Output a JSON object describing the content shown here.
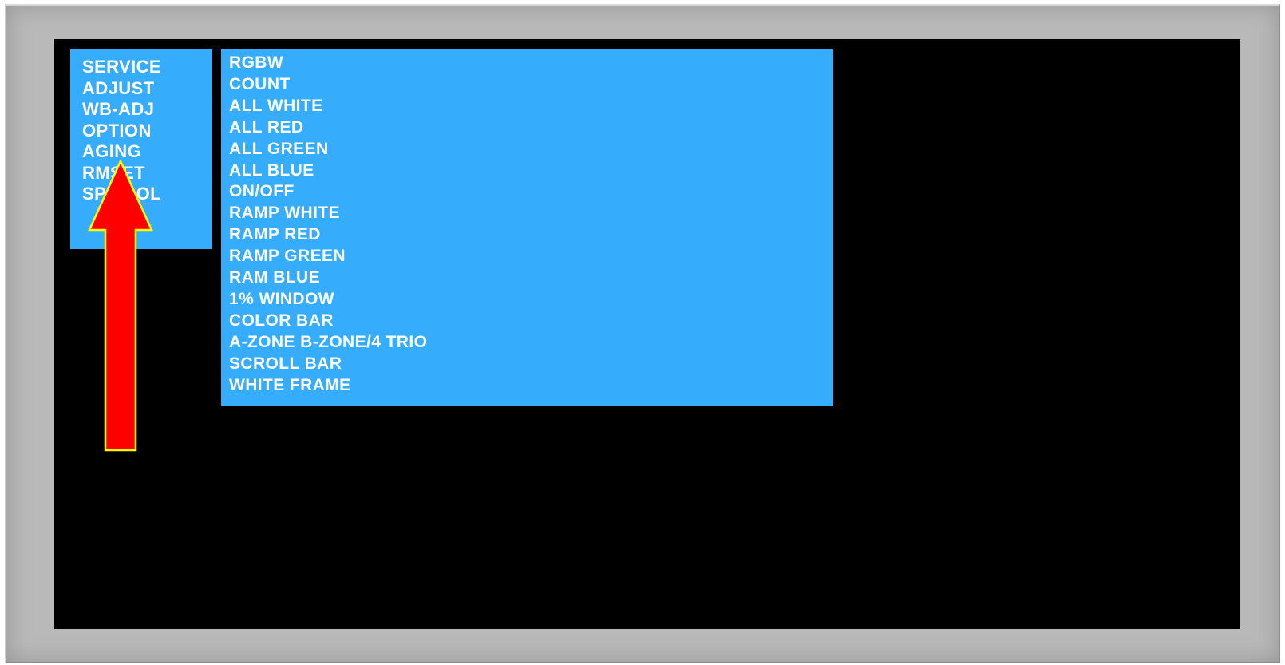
{
  "service_menu": {
    "items": [
      {
        "label": "SERVICE"
      },
      {
        "label": "ADJUST"
      },
      {
        "label": "WB-ADJ"
      },
      {
        "label": "OPTION"
      },
      {
        "label": "AGING"
      },
      {
        "label": "RMSET"
      },
      {
        "label": "SPITOOL"
      }
    ]
  },
  "aging_submenu": {
    "items": [
      {
        "label": "RGBW"
      },
      {
        "label": "COUNT"
      },
      {
        "label": "ALL WHITE"
      },
      {
        "label": "ALL RED"
      },
      {
        "label": "ALL GREEN"
      },
      {
        "label": "ALL BLUE"
      },
      {
        "label": "ON/OFF"
      },
      {
        "label": "RAMP WHITE"
      },
      {
        "label": "RAMP RED"
      },
      {
        "label": "RAMP GREEN"
      },
      {
        "label": "RAM BLUE"
      },
      {
        "label": "1% WINDOW"
      },
      {
        "label": "COLOR BAR"
      },
      {
        "label": "A-ZONE B-ZONE/4 TRIO"
      },
      {
        "label": "SCROLL BAR"
      },
      {
        "label": "WHITE FRAME"
      }
    ]
  },
  "colors": {
    "menu_background": "#36acfc",
    "menu_text": "#ffffff",
    "screen_background": "#000000",
    "bezel": "#b9b9b9",
    "arrow_fill": "#ff0000",
    "arrow_outline": "#ffff00"
  },
  "annotation": {
    "icon": "up-arrow-icon",
    "points_to": "AGING"
  }
}
